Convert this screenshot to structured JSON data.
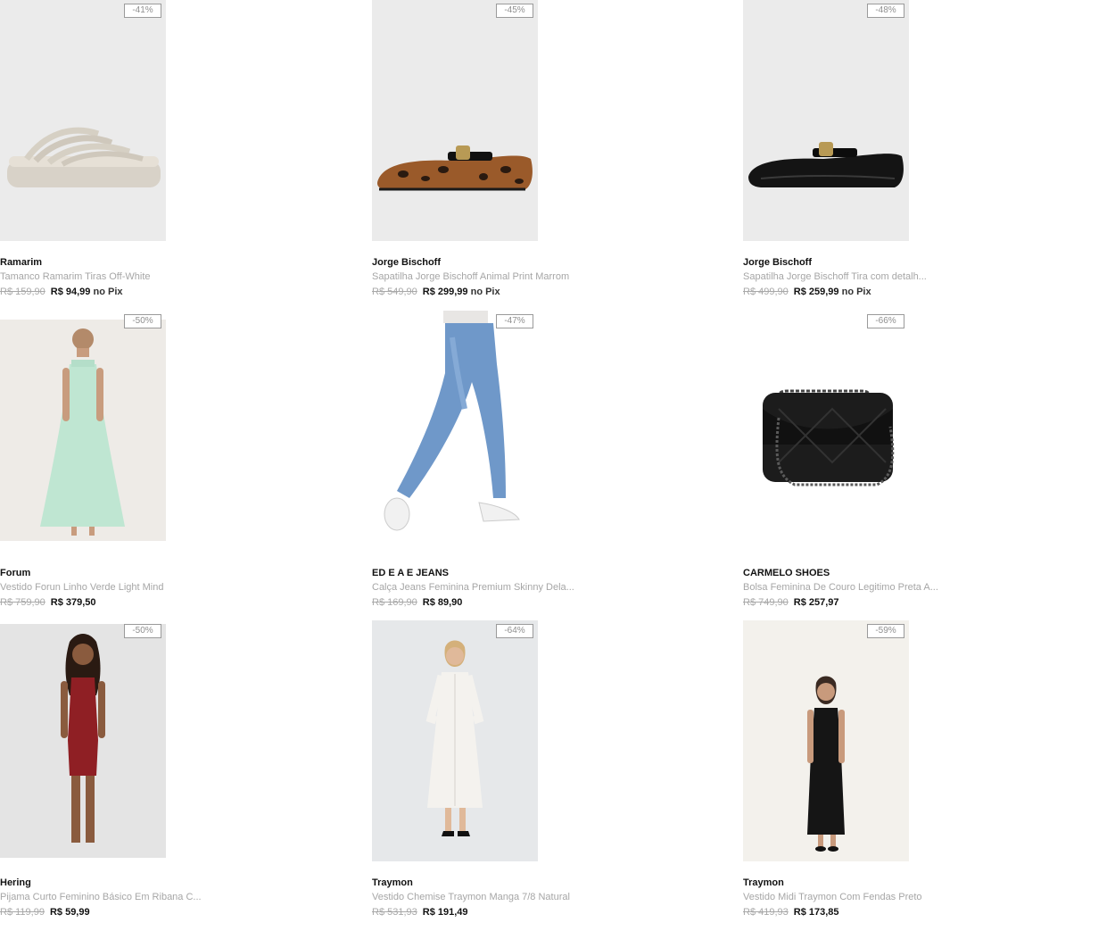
{
  "products": [
    {
      "brand": "Ramarim",
      "name": "Tamanco Ramarim Tiras Off-White",
      "old_price": "R$ 159,90",
      "price": "R$ 94,99",
      "pix": "no Pix",
      "discount": "-41%",
      "image": "sandal-photo"
    },
    {
      "brand": "Jorge Bischoff",
      "name": "Sapatilha Jorge Bischoff Animal Print Marrom",
      "old_price": "R$ 549,90",
      "price": "R$ 299,99",
      "pix": "no Pix",
      "discount": "-45%",
      "image": "leopard-flat-photo"
    },
    {
      "brand": "Jorge Bischoff",
      "name": "Sapatilha Jorge Bischoff Tira com detalh...",
      "old_price": "R$ 499,90",
      "price": "R$ 259,99",
      "pix": "no Pix",
      "discount": "-48%",
      "image": "black-flat-photo"
    },
    {
      "brand": "Forum",
      "name": "Vestido Forun Linho Verde Light Mind",
      "old_price": "R$ 759,90",
      "price": "R$ 379,50",
      "pix": "",
      "discount": "-50%",
      "image": "mint-dress-photo"
    },
    {
      "brand": "ED E A E JEANS",
      "name": "Calça Jeans Feminina Premium Skinny Dela...",
      "old_price": "R$ 169,90",
      "price": "R$ 89,90",
      "pix": "",
      "discount": "-47%",
      "image": "jeans-photo"
    },
    {
      "brand": "CARMELO SHOES",
      "name": "Bolsa Feminina De Couro Legitimo Preta A...",
      "old_price": "R$ 749,90",
      "price": "R$ 257,97",
      "pix": "",
      "discount": "-66%",
      "image": "black-bag-photo"
    },
    {
      "brand": "Hering",
      "name": "Pijama Curto Feminino Básico Em Ribana C...",
      "old_price": "R$ 119,99",
      "price": "R$ 59,99",
      "pix": "",
      "discount": "-50%",
      "image": "red-romper-photo"
    },
    {
      "brand": "Traymon",
      "name": "Vestido Chemise Traymon Manga 7/8 Natural",
      "old_price": "R$ 531,93",
      "price": "R$ 191,49",
      "pix": "",
      "discount": "-64%",
      "image": "white-shirt-dress-photo"
    },
    {
      "brand": "Traymon",
      "name": "Vestido Midi Traymon Com Fendas Preto",
      "old_price": "R$ 419,93",
      "price": "R$ 173,85",
      "pix": "",
      "discount": "-59%",
      "image": "black-midi-dress-photo"
    }
  ]
}
